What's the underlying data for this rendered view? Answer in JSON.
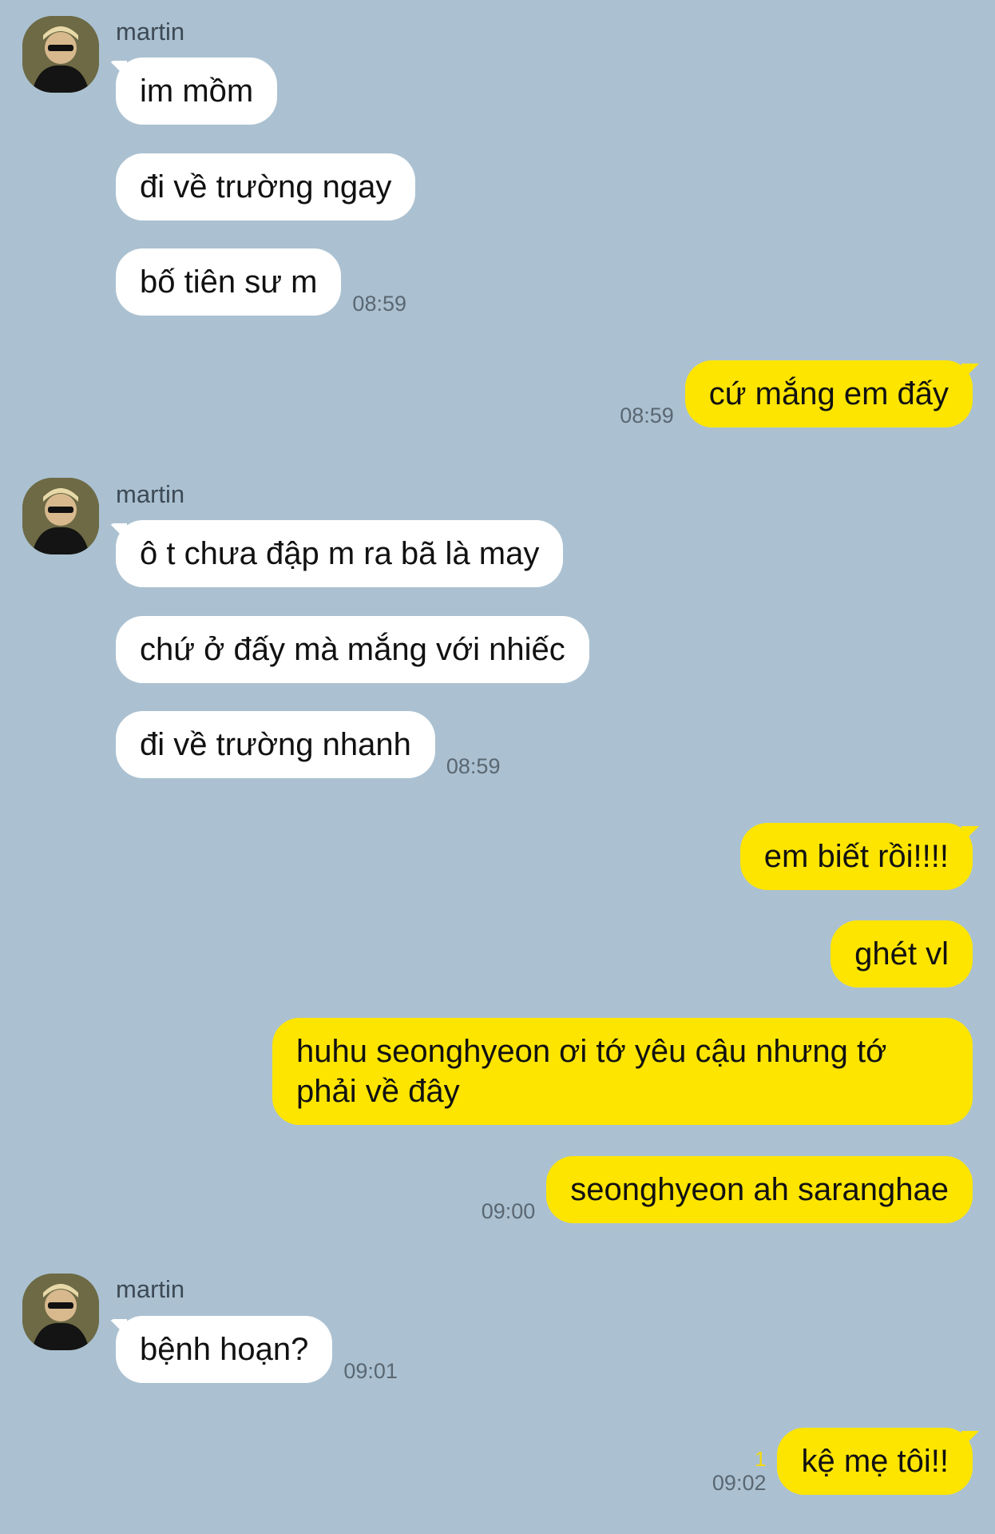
{
  "sender_name": "martin",
  "messages": {
    "g1": {
      "m1": "im mồm",
      "m2": "đi về trường ngay",
      "m3": "bố tiên sư m",
      "time": "08:59"
    },
    "o1": {
      "m1": "cứ mắng em đấy",
      "time": "08:59"
    },
    "g2": {
      "m1": "ô t chưa đập m ra bã là may",
      "m2": "chứ ở đấy mà mắng với nhiếc",
      "m3": "đi về trường nhanh",
      "time": "08:59"
    },
    "o2": {
      "m1": "em biết rồi!!!!",
      "m2": "ghét vl",
      "m3": "huhu seonghyeon ơi tớ yêu cậu nhưng tớ phải về đây",
      "m4": "seonghyeon ah saranghae",
      "time": "09:00"
    },
    "g3": {
      "m1": "bệnh hoạn?",
      "time": "09:01"
    },
    "o3": {
      "m1": "kệ mẹ tôi!!",
      "time": "09:02",
      "unread": "1"
    }
  },
  "colors": {
    "background": "#abc1d1",
    "incoming_bubble": "#ffffff",
    "outgoing_bubble": "#fee500"
  },
  "icons": {
    "avatar": "profile-photo"
  }
}
